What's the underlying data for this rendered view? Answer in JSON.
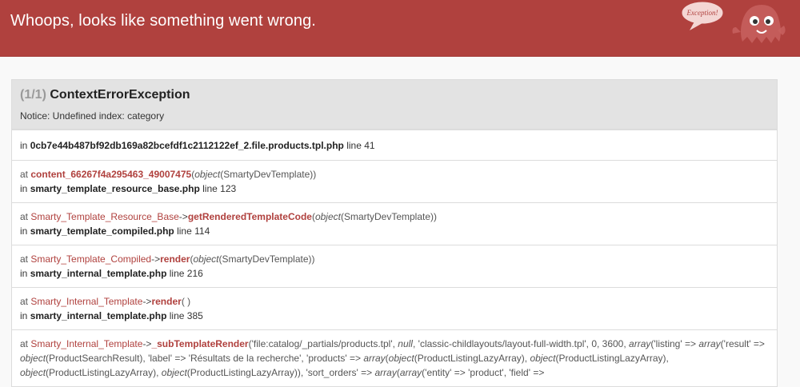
{
  "header": {
    "title": "Whoops, looks like something went wrong."
  },
  "exception": {
    "count": "(1/1)",
    "class": "ContextErrorException",
    "message": "Notice: Undefined index: category"
  },
  "trace": [
    {
      "in_label": "in",
      "file": "0cb7e44b487bf92db169a82bcefdf1c2112122ef_2.file.products.tpl.php",
      "line_label": "line 41"
    },
    {
      "at_label": "at",
      "function": "content_66267f4a295463_49007475",
      "args_open": "(",
      "arg_type": "object",
      "arg_class": "(SmartyDevTemplate)",
      "args_close": ")",
      "in_label": "in",
      "file": "smarty_template_resource_base.php",
      "line_label": "line 123"
    },
    {
      "at_label": "at",
      "class": "Smarty_Template_Resource_Base",
      "arrow": "->",
      "function": "getRenderedTemplateCode",
      "args_open": "(",
      "arg_type": "object",
      "arg_class": "(SmartyDevTemplate)",
      "args_close": ")",
      "in_label": "in",
      "file": "smarty_template_compiled.php",
      "line_label": "line 114"
    },
    {
      "at_label": "at",
      "class": "Smarty_Template_Compiled",
      "arrow": "->",
      "function": "render",
      "args_open": "(",
      "arg_type": "object",
      "arg_class": "(SmartyDevTemplate)",
      "args_close": ")",
      "in_label": "in",
      "file": "smarty_internal_template.php",
      "line_label": "line 216"
    },
    {
      "at_label": "at",
      "class": "Smarty_Internal_Template",
      "arrow": "->",
      "function": "render",
      "args": "( )",
      "in_label": "in",
      "file": "smarty_internal_template.php",
      "line_label": "line 385"
    },
    {
      "at_label": "at",
      "class": "Smarty_Internal_Template",
      "arrow": "->",
      "function": "_subTemplateRender",
      "args_text_1": "('file:catalog/_partials/products.tpl', ",
      "null_kw": "null",
      "args_text_2": ", 'classic-childlayouts/layout-full-width.tpl', 0, 3600, ",
      "array_kw_1": "array",
      "args_text_3": "('listing' =>",
      "array_kw_2": "array",
      "args_text_4": "('result' => ",
      "object_kw_1": "object",
      "args_text_5": "(ProductSearchResult), 'label' => 'Résultats de la recherche', 'products' => ",
      "array_kw_3": "array",
      "args_text_6": "(",
      "object_kw_2": "object",
      "args_text_7": "(ProductListingLazyArray),",
      "object_kw_3": "object",
      "args_text_8": "(ProductListingLazyArray), ",
      "object_kw_4": "object",
      "args_text_9": "(ProductListingLazyArray), ",
      "object_kw_5": "object",
      "args_text_10": "(ProductListingLazyArray)), 'sort_orders' => ",
      "array_kw_4": "array",
      "args_text_11": "(",
      "array_kw_5": "array",
      "args_text_12": "('entity' => 'product', 'field' =>"
    }
  ],
  "logo": {
    "speech_text": "Exception!",
    "icon": "ghost-icon"
  },
  "colors": {
    "header_bg": "#b0413e",
    "accent": "#b0413e"
  }
}
